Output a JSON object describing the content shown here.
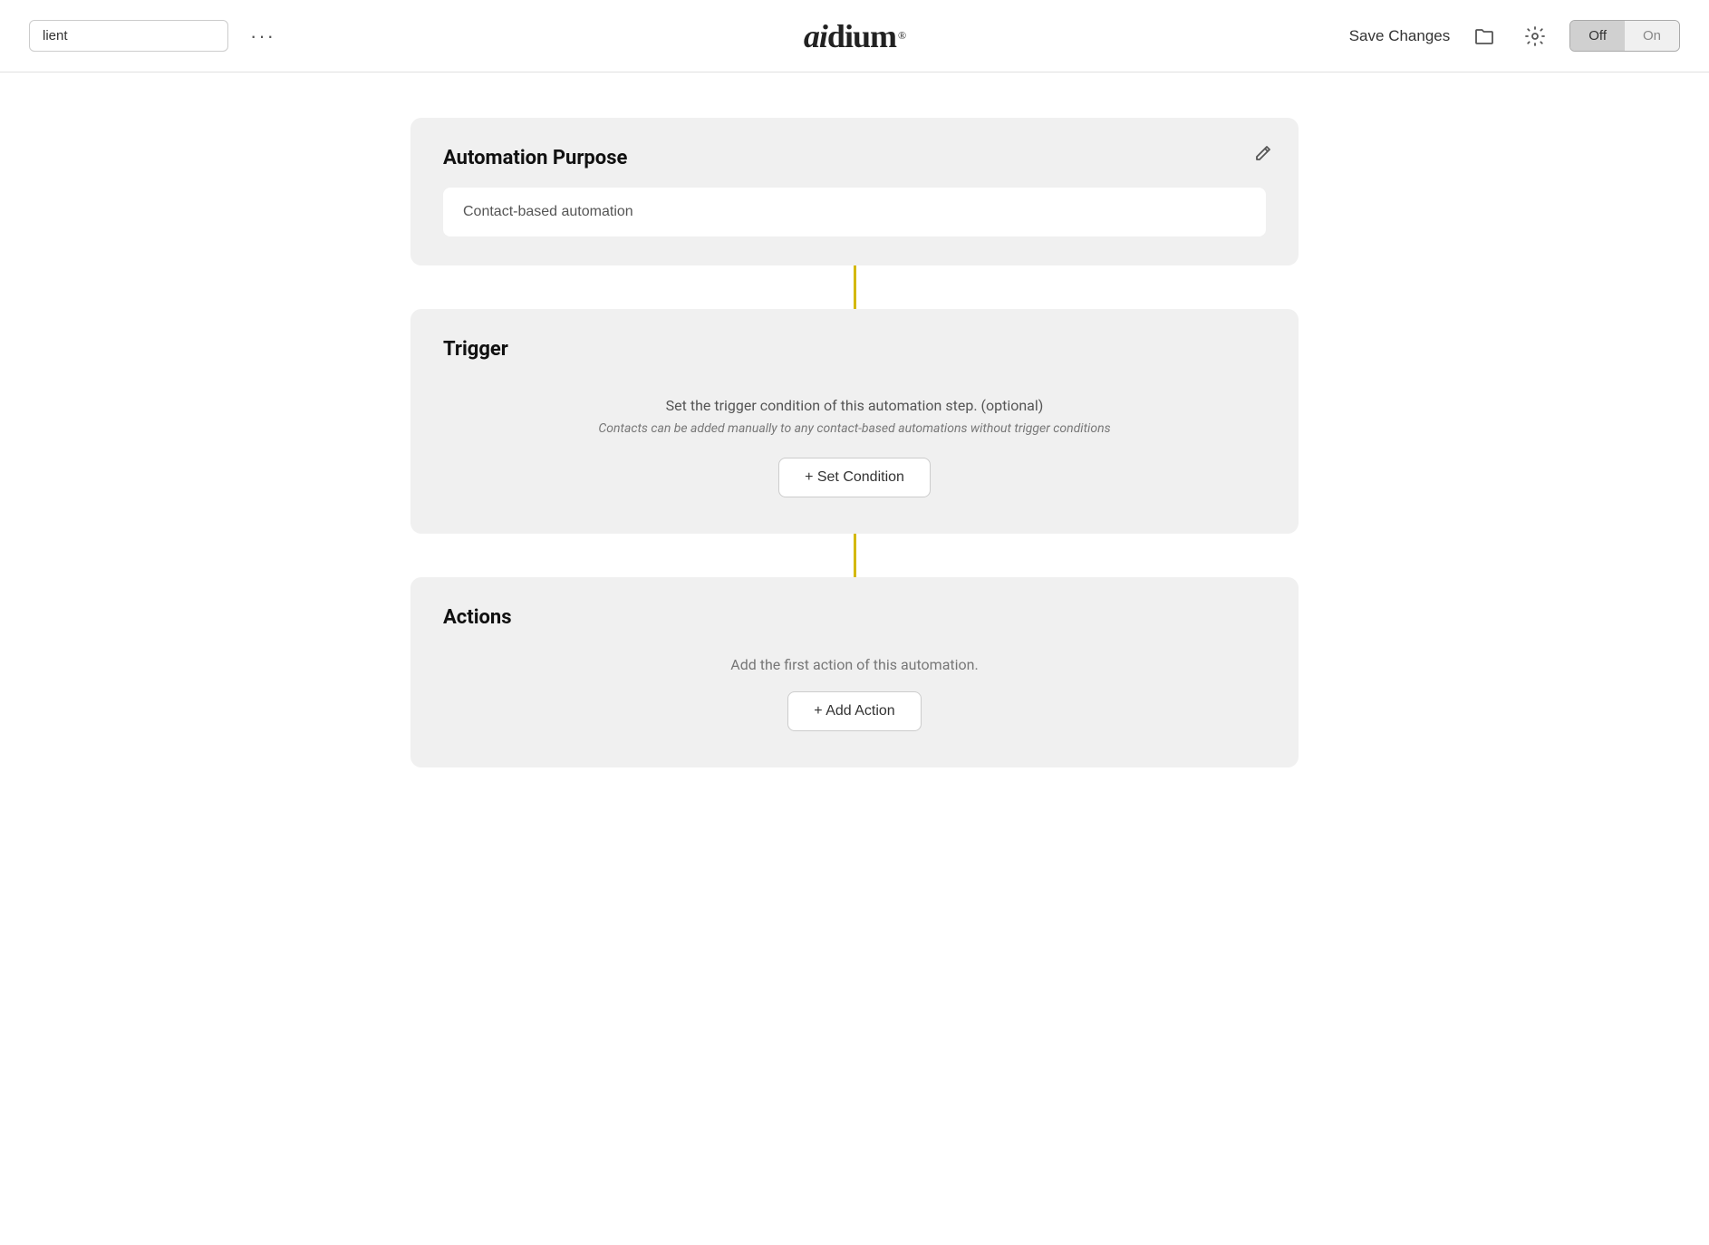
{
  "navbar": {
    "search_placeholder": "lient",
    "search_value": "lient",
    "more_label": "···",
    "logo": "aidium",
    "save_changes_label": "Save Changes",
    "toggle_off_label": "Off",
    "toggle_on_label": "On",
    "toggle_active": "off"
  },
  "automation_purpose": {
    "title": "Automation Purpose",
    "edit_icon": "edit",
    "input_value": "Contact-based automation",
    "input_placeholder": "Contact-based automation"
  },
  "trigger": {
    "title": "Trigger",
    "description": "Set the trigger condition of this automation step. (optional)",
    "note": "Contacts can be added manually to any contact-based automations without trigger conditions",
    "set_condition_label": "+ Set Condition"
  },
  "actions": {
    "title": "Actions",
    "description": "Add the first action of this automation.",
    "add_action_label": "+ Add Action"
  },
  "colors": {
    "connector": "#d4b800",
    "accent": "#d4b800"
  }
}
